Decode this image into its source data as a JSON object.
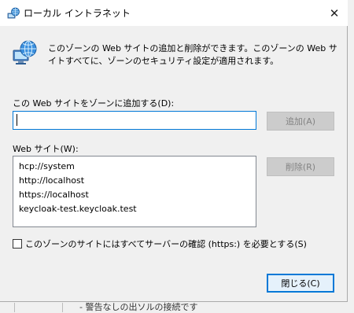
{
  "window": {
    "title": "ローカル イントラネット",
    "close_glyph": "✕"
  },
  "description": "このゾーンの Web サイトの追加と削除ができます。このゾーンの Web サイトすべてに、ゾーンのセキュリティ設定が適用されます。",
  "add_section": {
    "label": "この Web サイトをゾーンに追加する(D):",
    "input_value": "",
    "add_button": "追加(A)"
  },
  "sites_section": {
    "label": "Web サイト(W):",
    "items": [
      "hcp://system",
      "http://localhost",
      "https://localhost",
      "keycloak-test.keycloak.test"
    ],
    "remove_button": "削除(R)"
  },
  "https_checkbox": {
    "label": "このゾーンのサイトにはすべてサーバーの確認 (https:) を必要とする(S)",
    "checked": false
  },
  "close_button": "閉じる(C)",
  "background_window": {
    "text": "- 警告なしの出ソルの接続です"
  },
  "colors": {
    "accent": "#0078d7",
    "dialog_bg": "#f0f0f0",
    "title_bg": "#ffffff",
    "disabled_button_bg": "#cccccc",
    "disabled_text": "#838383"
  },
  "icons": {
    "title_icon": "intranet-globe-icon",
    "zone_icon": "intranet-zone-icon",
    "close_icon": "close-icon"
  }
}
